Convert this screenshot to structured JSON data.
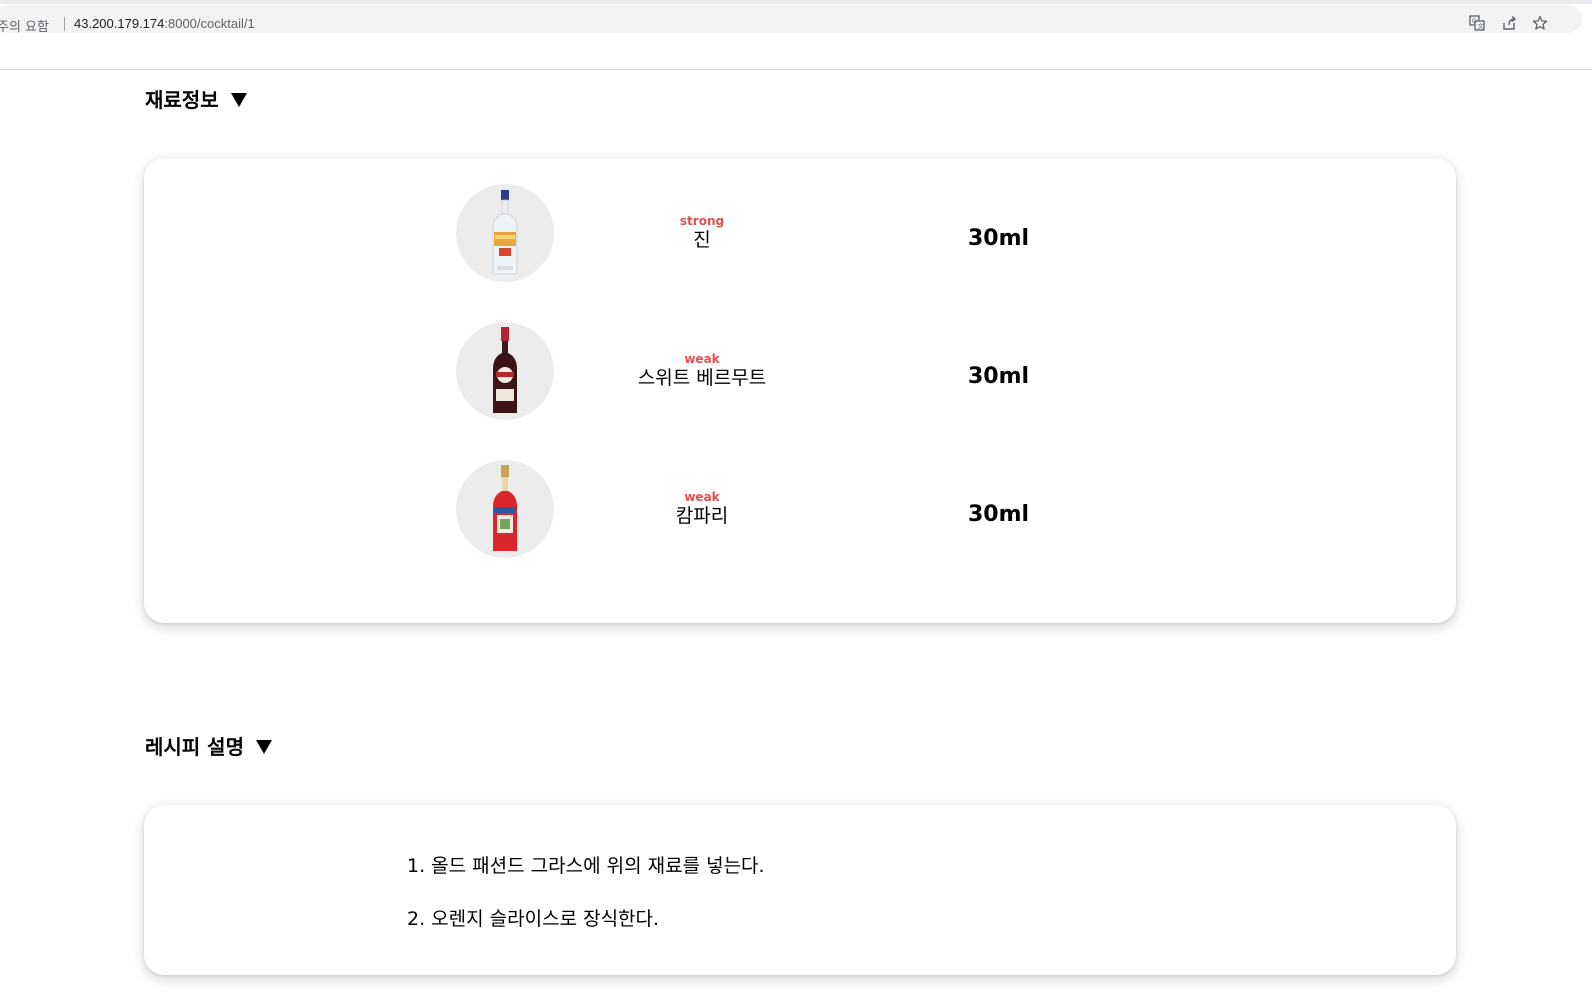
{
  "browser": {
    "security_label": "주의 요함",
    "url_host": "43.200.179.174",
    "url_path": ":8000/cocktail/1",
    "icons": [
      "translate-icon",
      "share-icon",
      "bookmark-star-icon"
    ]
  },
  "ingredients_section": {
    "title": "재료정보",
    "items": [
      {
        "strength": "strong",
        "name": "진",
        "amount": "30ml",
        "image": "gin-bottle"
      },
      {
        "strength": "weak",
        "name": "스위트 베르무트",
        "amount": "30ml",
        "image": "vermouth-bottle"
      },
      {
        "strength": "weak",
        "name": "캄파리",
        "amount": "30ml",
        "image": "campari-bottle"
      }
    ]
  },
  "recipe_section": {
    "title": "레시피 설명",
    "steps": [
      "1. 올드 패션드 그라스에 위의 재료를 넣는다.",
      "2. 오렌지 슬라이스로 장식한다."
    ]
  },
  "colors": {
    "strength_label": "#e05050",
    "image_circle": "#ececec"
  }
}
